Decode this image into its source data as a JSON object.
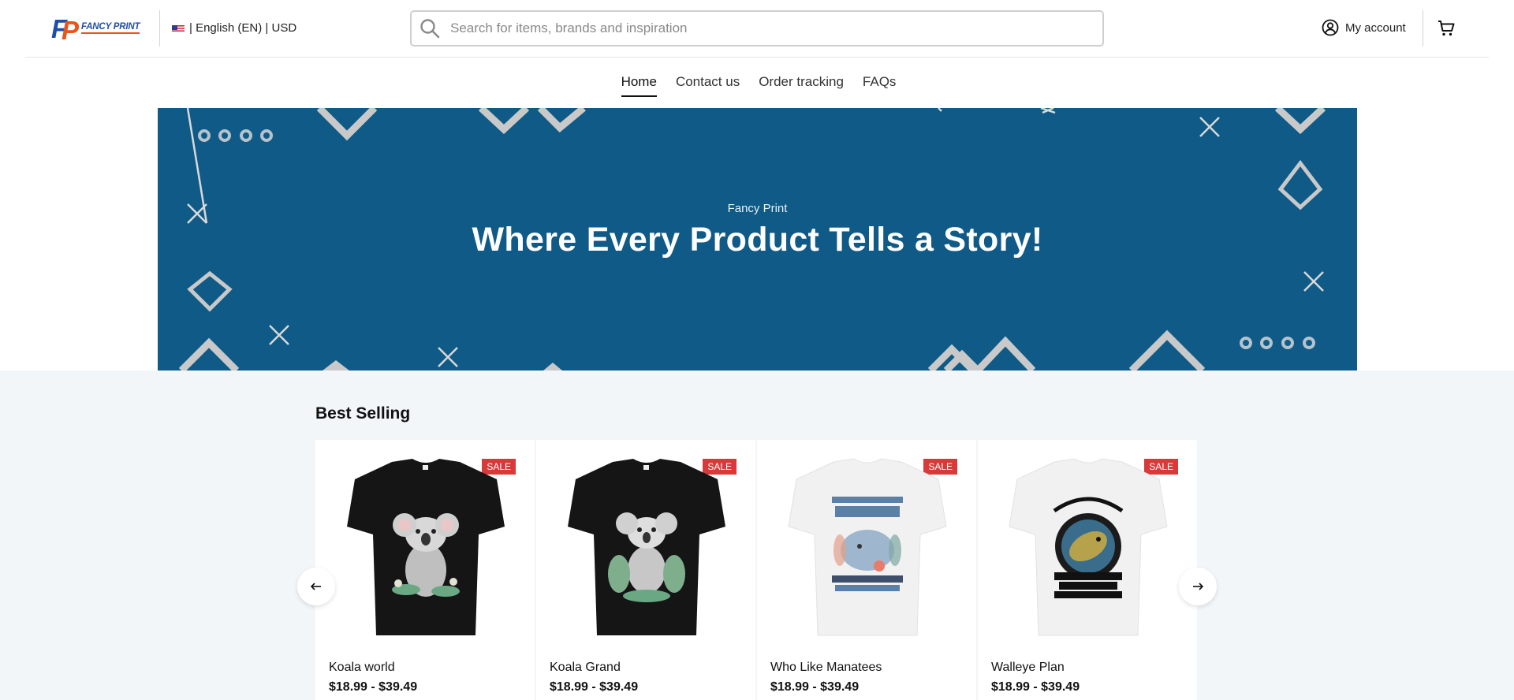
{
  "header": {
    "logo_text": "FANCY PRINT",
    "locale": "| English (EN) | USD",
    "search_placeholder": "Search for items, brands and inspiration",
    "account_label": "My account"
  },
  "nav": {
    "items": [
      "Home",
      "Contact us",
      "Order tracking",
      "FAQs"
    ],
    "active": "Home"
  },
  "hero": {
    "subtitle": "Fancy Print",
    "title": "Where Every Product Tells a Story!",
    "bg_color": "#0f5a86"
  },
  "best_selling": {
    "title": "Best Selling",
    "products": [
      {
        "name": "Koala world",
        "price": "$18.99 - $39.49",
        "badge": "SALE",
        "shirt_color": "black"
      },
      {
        "name": "Koala Grand",
        "price": "$18.99 - $39.49",
        "badge": "SALE",
        "shirt_color": "black"
      },
      {
        "name": "Who Like Manatees",
        "price": "$18.99 - $39.49",
        "badge": "SALE",
        "shirt_color": "white"
      },
      {
        "name": "Walleye Plan",
        "price": "$18.99 - $39.49",
        "badge": "SALE",
        "shirt_color": "white"
      }
    ]
  },
  "colors": {
    "accent_red": "#d83a3a",
    "brand_blue": "#1f4ea8",
    "brand_orange": "#e8541c"
  },
  "icons": [
    "search-icon",
    "user-circle-icon",
    "cart-icon",
    "arrow-left-icon",
    "arrow-right-icon",
    "us-flag-icon"
  ]
}
